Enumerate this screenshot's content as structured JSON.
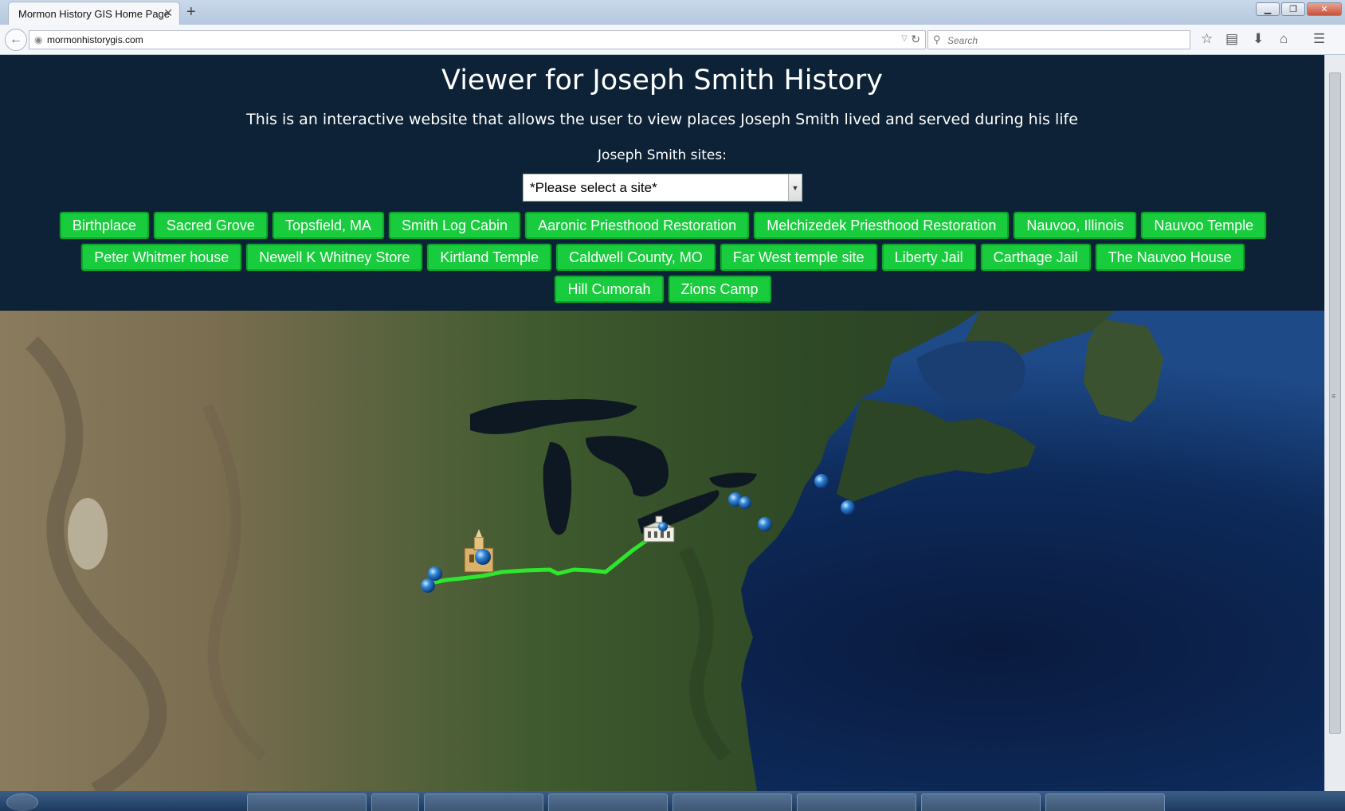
{
  "browser": {
    "tab_title": "Mormon History GIS Home Page",
    "url": "mormonhistorygis.com",
    "search_placeholder": "Search"
  },
  "page": {
    "title": "Viewer for Joseph Smith History",
    "subtitle": "This is an interactive website that allows the user to view places Joseph Smith lived and served during his life",
    "sites_label": "Joseph Smith sites:",
    "select_value": "*Please select a site*"
  },
  "site_buttons": [
    "Birthplace",
    "Sacred Grove",
    "Topsfield, MA",
    "Smith Log Cabin",
    "Aaronic Priesthood Restoration",
    "Melchizedek Priesthood Restoration",
    "Nauvoo, Illinois",
    "Nauvoo Temple",
    "Peter Whitmer house",
    "Newell K Whitney Store",
    "Kirtland Temple",
    "Caldwell County, MO",
    "Far West temple site",
    "Liberty Jail",
    "Carthage Jail",
    "The Nauvoo House",
    "Hill Cumorah",
    "Zions Camp"
  ],
  "map": {
    "route_color": "#2ee62e",
    "marker_icon": "blue-globe-pin-icon",
    "temple_icons": [
      "nauvoo-temple-icon",
      "kirtland-temple-icon"
    ]
  }
}
